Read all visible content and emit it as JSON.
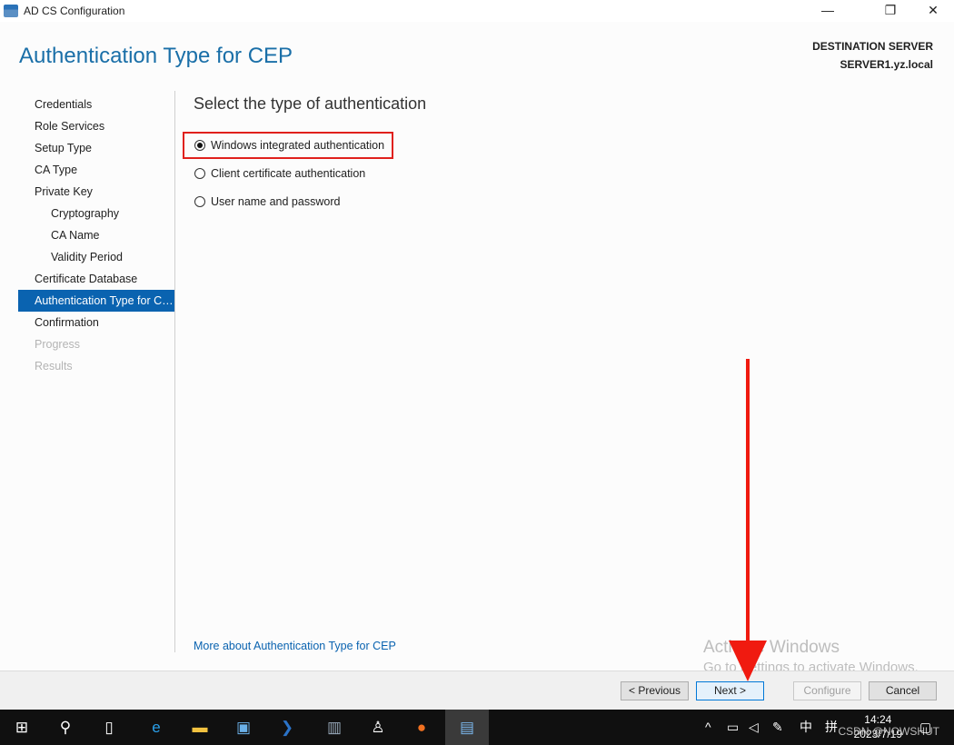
{
  "window": {
    "title": "AD CS Configuration",
    "minimize": "—",
    "restore": "❐",
    "close": "✕"
  },
  "header": {
    "title": "Authentication Type for CEP",
    "dest_label": "DESTINATION SERVER",
    "dest_server": "SERVER1.yz.local"
  },
  "nav": [
    {
      "label": "Credentials",
      "state": "normal"
    },
    {
      "label": "Role Services",
      "state": "normal"
    },
    {
      "label": "Setup Type",
      "state": "normal"
    },
    {
      "label": "CA Type",
      "state": "normal"
    },
    {
      "label": "Private Key",
      "state": "normal"
    },
    {
      "label": "Cryptography",
      "state": "sub"
    },
    {
      "label": "CA Name",
      "state": "sub"
    },
    {
      "label": "Validity Period",
      "state": "sub"
    },
    {
      "label": "Certificate Database",
      "state": "normal"
    },
    {
      "label": "Authentication Type for CEP",
      "state": "active"
    },
    {
      "label": "Confirmation",
      "state": "normal"
    },
    {
      "label": "Progress",
      "state": "disabled"
    },
    {
      "label": "Results",
      "state": "disabled"
    }
  ],
  "main": {
    "heading": "Select the type of authentication",
    "options": [
      {
        "label": "Windows integrated authentication",
        "selected": true
      },
      {
        "label": "Client certificate authentication",
        "selected": false
      },
      {
        "label": "User name and password",
        "selected": false
      }
    ],
    "more_link": "More about Authentication Type for CEP"
  },
  "buttons": {
    "previous": "< Previous",
    "next": "Next >",
    "configure": "Configure",
    "cancel": "Cancel"
  },
  "watermark": {
    "line1": "Activate Windows",
    "line2": "Go to Settings to activate Windows."
  },
  "taskbar": {
    "ime": "中",
    "ime2": "拼",
    "time": "14:24",
    "date": "2023/7/19",
    "credit": "CSDN @NOWSHUT"
  },
  "colors": {
    "accent": "#0a63b0",
    "highlight": "#e0201c"
  }
}
